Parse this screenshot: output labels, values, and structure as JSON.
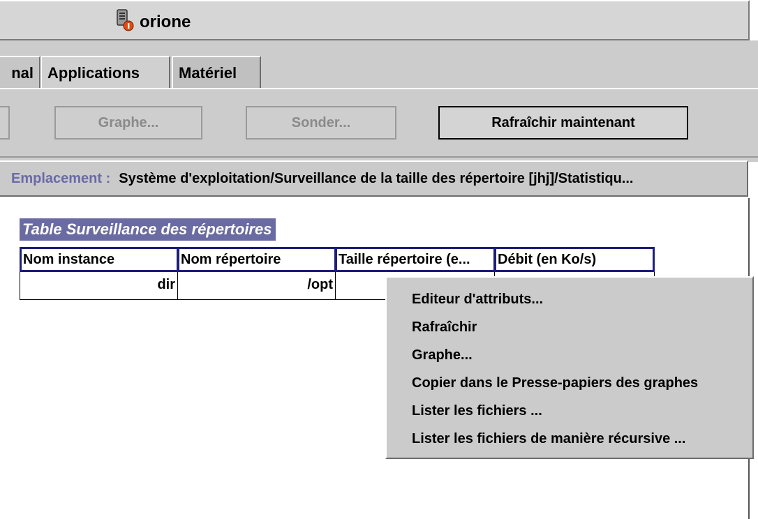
{
  "window": {
    "title": "orione",
    "icon": "server-alert-icon"
  },
  "tabs": [
    {
      "label": "nal"
    },
    {
      "label": "Applications"
    },
    {
      "label": "Matériel"
    }
  ],
  "toolbar": {
    "graph_label": "Graphe...",
    "probe_label": "Sonder...",
    "refresh_label": "Rafraîchir maintenant"
  },
  "location": {
    "label": "Emplacement :",
    "path": "Système d'exploitation/Surveillance de la taille des répertoire [jhj]/Statistiqu..."
  },
  "table": {
    "title": "Table Surveillance des répertoires",
    "columns": [
      "Nom instance",
      "Nom répertoire",
      "Taille répertoire (e...",
      "Débit (en Ko/s)"
    ],
    "rows": [
      [
        "dir",
        "/opt",
        "",
        ""
      ]
    ]
  },
  "context_menu": {
    "items": [
      "Editeur d'attributs...",
      "Rafraîchir",
      "Graphe...",
      "Copier dans le Presse-papiers des graphes",
      "Lister les fichiers ...",
      "Lister les fichiers de manière récursive ..."
    ]
  },
  "colors": {
    "chrome": "#cccccc",
    "selection": "#6b6ba3",
    "header_border": "#1e1e7a",
    "location_label": "#6a6aa8"
  }
}
